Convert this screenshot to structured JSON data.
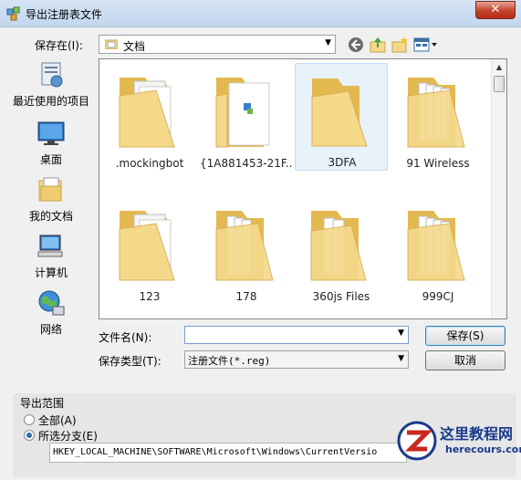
{
  "window": {
    "title": "导出注册表文件",
    "close_label": "✕"
  },
  "savein": {
    "label": "保存在(I):",
    "value": "文档"
  },
  "places": [
    {
      "label": "最近使用的项目"
    },
    {
      "label": "桌面"
    },
    {
      "label": "我的文档"
    },
    {
      "label": "计算机"
    },
    {
      "label": "网络"
    }
  ],
  "files": [
    {
      "name": ".mockingbot"
    },
    {
      "name": "{1A881453-21F..."
    },
    {
      "name": "3DFA"
    },
    {
      "name": "91 Wireless"
    },
    {
      "name": "123"
    },
    {
      "name": "178"
    },
    {
      "name": "360js Files"
    },
    {
      "name": "999CJ"
    }
  ],
  "filename": {
    "label": "文件名(N):",
    "value": ""
  },
  "filetype": {
    "label": "保存类型(T):",
    "value": "注册文件(*.reg)"
  },
  "buttons": {
    "save": "保存(S)",
    "cancel": "取消"
  },
  "export_range": {
    "title": "导出范围",
    "all_label": "全部(A)",
    "selected_label": "所选分支(E)",
    "selected_checked": true,
    "branch_path": "HKEY_LOCAL_MACHINE\\SOFTWARE\\Microsoft\\Windows\\CurrentVersio"
  },
  "watermark": {
    "text": "这里教程网",
    "url": "herecours.com"
  },
  "colors": {
    "folder": "#f5d98a",
    "folder_dark": "#e3b94f",
    "accent": "#3c7fb1"
  }
}
